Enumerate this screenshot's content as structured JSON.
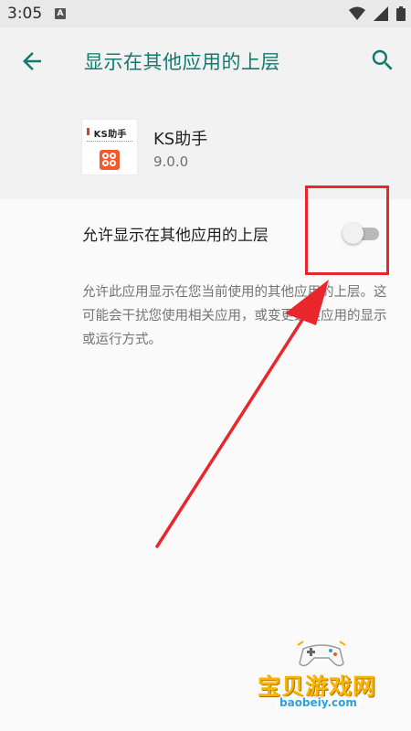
{
  "status_bar": {
    "time": "3:05",
    "notification_icon": "a-icon",
    "icons": [
      "wifi-icon",
      "signal-icon",
      "battery-icon"
    ]
  },
  "app_bar": {
    "title": "显示在其他应用的上层",
    "back_icon": "arrow-left-icon",
    "search_icon": "search-icon",
    "accent_color": "#127a6e"
  },
  "app_info": {
    "icon_text": "KS助手",
    "name": "KS助手",
    "version": "9.0.0"
  },
  "setting": {
    "label": "允许显示在其他应用的上层",
    "enabled": false
  },
  "description": "允许此应用显示在您当前使用的其他应用的上层。这可能会干扰您使用相关应用，或变更这类应用的显示或运行方式。",
  "annotation": {
    "box_color": "#e8262b"
  },
  "watermark": {
    "title": "宝贝游戏网",
    "url": "baobeiy.com"
  }
}
